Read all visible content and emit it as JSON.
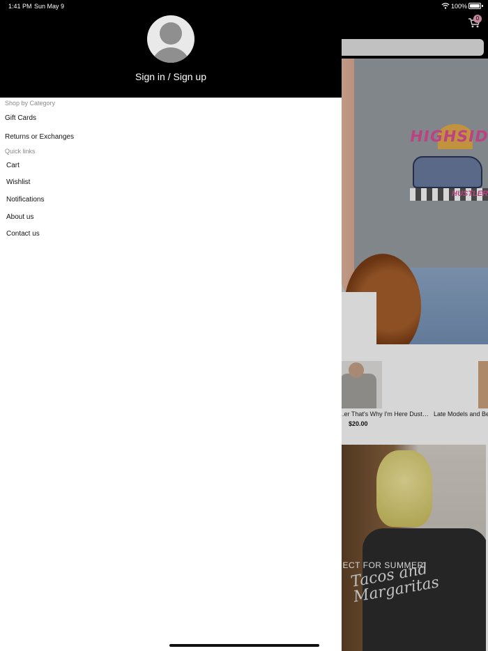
{
  "status_bar": {
    "time": "1:41 PM",
    "date": "Sun May 9",
    "battery": "100%"
  },
  "app": {
    "cart_badge": "0",
    "hero_print_text": "HIGHSIDE",
    "hero_print_sub": "HUSTLER",
    "products": [
      {
        "name": "...er That's Why I'm Here Dust Sh...",
        "price": "$20.00"
      },
      {
        "name": "Late Models and Bee",
        "price": ""
      }
    ],
    "banner_script": "Tacos and Margaritas",
    "banner_text": "...ECT FOR SUMMER"
  },
  "drawer": {
    "signin_label": "Sign in / Sign up",
    "shop_section_label": "Shop by Category",
    "categories": [
      {
        "label": "Gift Cards"
      },
      {
        "label": "Returns or Exchanges"
      }
    ],
    "quick_section_label": "Quick links",
    "quick_links": [
      {
        "label": "Cart"
      },
      {
        "label": "Wishlist"
      },
      {
        "label": "Notifications"
      },
      {
        "label": "About us"
      },
      {
        "label": "Contact us"
      }
    ]
  },
  "colors": {
    "header_bg": "#000000",
    "drawer_bg": "#ffffff",
    "section_label": "#8a8a8a",
    "badge": "#e7a0b6"
  },
  "icons": [
    "wifi-icon",
    "battery-icon",
    "cart-icon",
    "avatar-placeholder-icon"
  ]
}
